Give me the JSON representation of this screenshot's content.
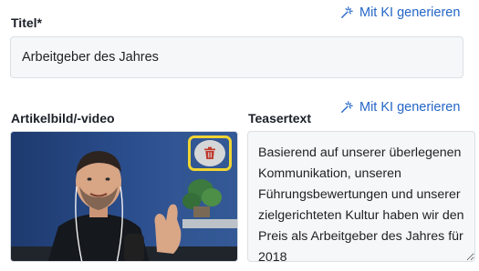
{
  "title_field": {
    "label": "Titel*",
    "value": "Arbeitgeber des Jahres",
    "ai_link": "Mit KI generieren"
  },
  "media_field": {
    "label": "Artikelbild/-video",
    "delete_icon": "trash-icon"
  },
  "teaser_field": {
    "label": "Teasertext",
    "value": "Basierend auf unserer überlegenen Kommunikation, unseren Führungsbewertungen und unserer zielgerichteten Kultur haben wir den Preis als Arbeitgeber des Jahres für 2018",
    "ai_link": "Mit KI generieren"
  },
  "colors": {
    "accent": "#2466c8",
    "highlight": "#f0d432",
    "delete_icon": "#c0392b"
  }
}
